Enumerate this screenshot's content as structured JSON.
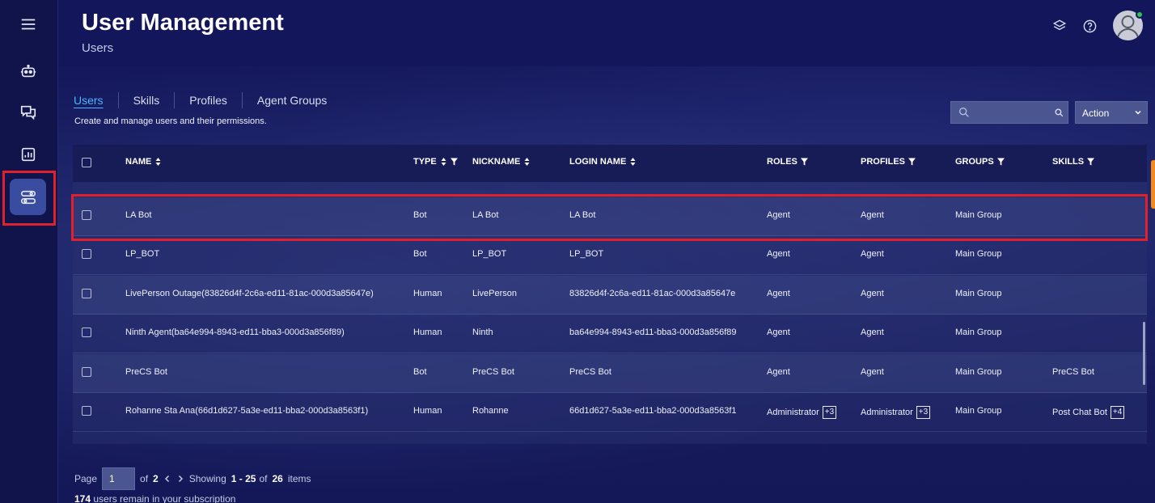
{
  "header": {
    "title": "User Management",
    "subtitle": "Users"
  },
  "sidebar": {
    "items": [
      {
        "name": "menu-icon"
      },
      {
        "name": "bot-icon"
      },
      {
        "name": "chat-icon"
      },
      {
        "name": "reports-icon"
      },
      {
        "name": "user-management-icon",
        "active": true
      }
    ]
  },
  "tabs": [
    "Users",
    "Skills",
    "Profiles",
    "Agent Groups"
  ],
  "tab_description": "Create and manage users and their permissions.",
  "search": {
    "placeholder": ""
  },
  "action_select": {
    "value": "Action"
  },
  "table": {
    "columns": [
      "NAME",
      "TYPE",
      "NICKNAME",
      "LOGIN NAME",
      "ROLES",
      "PROFILES",
      "GROUPS",
      "SKILLS"
    ],
    "rows": [
      {
        "name": "LA Bot",
        "type": "Bot",
        "nickname": "LA Bot",
        "login": "LA Bot",
        "roles": "Agent",
        "roles_more": "",
        "profiles": "Agent",
        "profiles_more": "",
        "groups": "Main Group",
        "skills": "",
        "skills_more": ""
      },
      {
        "name": "LP_BOT",
        "type": "Bot",
        "nickname": "LP_BOT",
        "login": "LP_BOT",
        "roles": "Agent",
        "roles_more": "",
        "profiles": "Agent",
        "profiles_more": "",
        "groups": "Main Group",
        "skills": "",
        "skills_more": ""
      },
      {
        "name": "LivePerson Outage(83826d4f-2c6a-ed11-81ac-000d3a85647e)",
        "type": "Human",
        "nickname": "LivePerson",
        "login": "83826d4f-2c6a-ed11-81ac-000d3a85647e",
        "roles": "Agent",
        "roles_more": "",
        "profiles": "Agent",
        "profiles_more": "",
        "groups": "Main Group",
        "skills": "",
        "skills_more": ""
      },
      {
        "name": "Ninth Agent(ba64e994-8943-ed11-bba3-000d3a856f89)",
        "type": "Human",
        "nickname": "Ninth",
        "login": "ba64e994-8943-ed11-bba3-000d3a856f89",
        "roles": "Agent",
        "roles_more": "",
        "profiles": "Agent",
        "profiles_more": "",
        "groups": "Main Group",
        "skills": "",
        "skills_more": ""
      },
      {
        "name": "PreCS Bot",
        "type": "Bot",
        "nickname": "PreCS Bot",
        "login": "PreCS Bot",
        "roles": "Agent",
        "roles_more": "",
        "profiles": "Agent",
        "profiles_more": "",
        "groups": "Main Group",
        "skills": "PreCS Bot",
        "skills_more": ""
      },
      {
        "name": "Rohanne Sta Ana(66d1d627-5a3e-ed11-bba2-000d3a8563f1)",
        "type": "Human",
        "nickname": "Rohanne",
        "login": "66d1d627-5a3e-ed11-bba2-000d3a8563f1",
        "roles": "Administrator",
        "roles_more": "+3",
        "profiles": "Administrator",
        "profiles_more": "+3",
        "groups": "Main Group",
        "skills": "Post Chat Bot",
        "skills_more": "+4"
      }
    ]
  },
  "footer": {
    "page_label": "Page",
    "page_value": "1",
    "of_label": "of",
    "total_pages": "2",
    "showing_label": "Showing",
    "range": "1 - 25",
    "of_label2": "of",
    "total_items": "26",
    "items_label": "items",
    "remaining": "174",
    "remaining_label": "users remain in your subscription"
  }
}
